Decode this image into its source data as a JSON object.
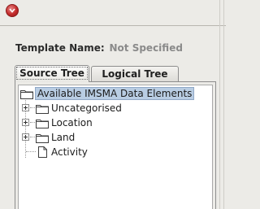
{
  "window": {
    "badge_icon": "chevron-down-icon",
    "badge_color": "#c32b2b"
  },
  "template": {
    "label": "Template Name:",
    "value": "Not Specified"
  },
  "tabs": [
    {
      "label": "Source Tree",
      "active": true
    },
    {
      "label": "Logical Tree",
      "active": false
    }
  ],
  "tree": {
    "root": {
      "label": "Available IMSMA Data Elements",
      "icon": "folder-icon",
      "selected": true
    },
    "children": [
      {
        "label": "Uncategorised",
        "icon": "folder-icon",
        "expandable": true
      },
      {
        "label": "Location",
        "icon": "folder-icon",
        "expandable": true
      },
      {
        "label": "Land",
        "icon": "folder-icon",
        "expandable": true
      },
      {
        "label": "Activity",
        "icon": "document-icon",
        "expandable": false
      }
    ]
  },
  "colors": {
    "selection_bg": "#b9cde3",
    "panel_bg": "#ecebe7"
  }
}
